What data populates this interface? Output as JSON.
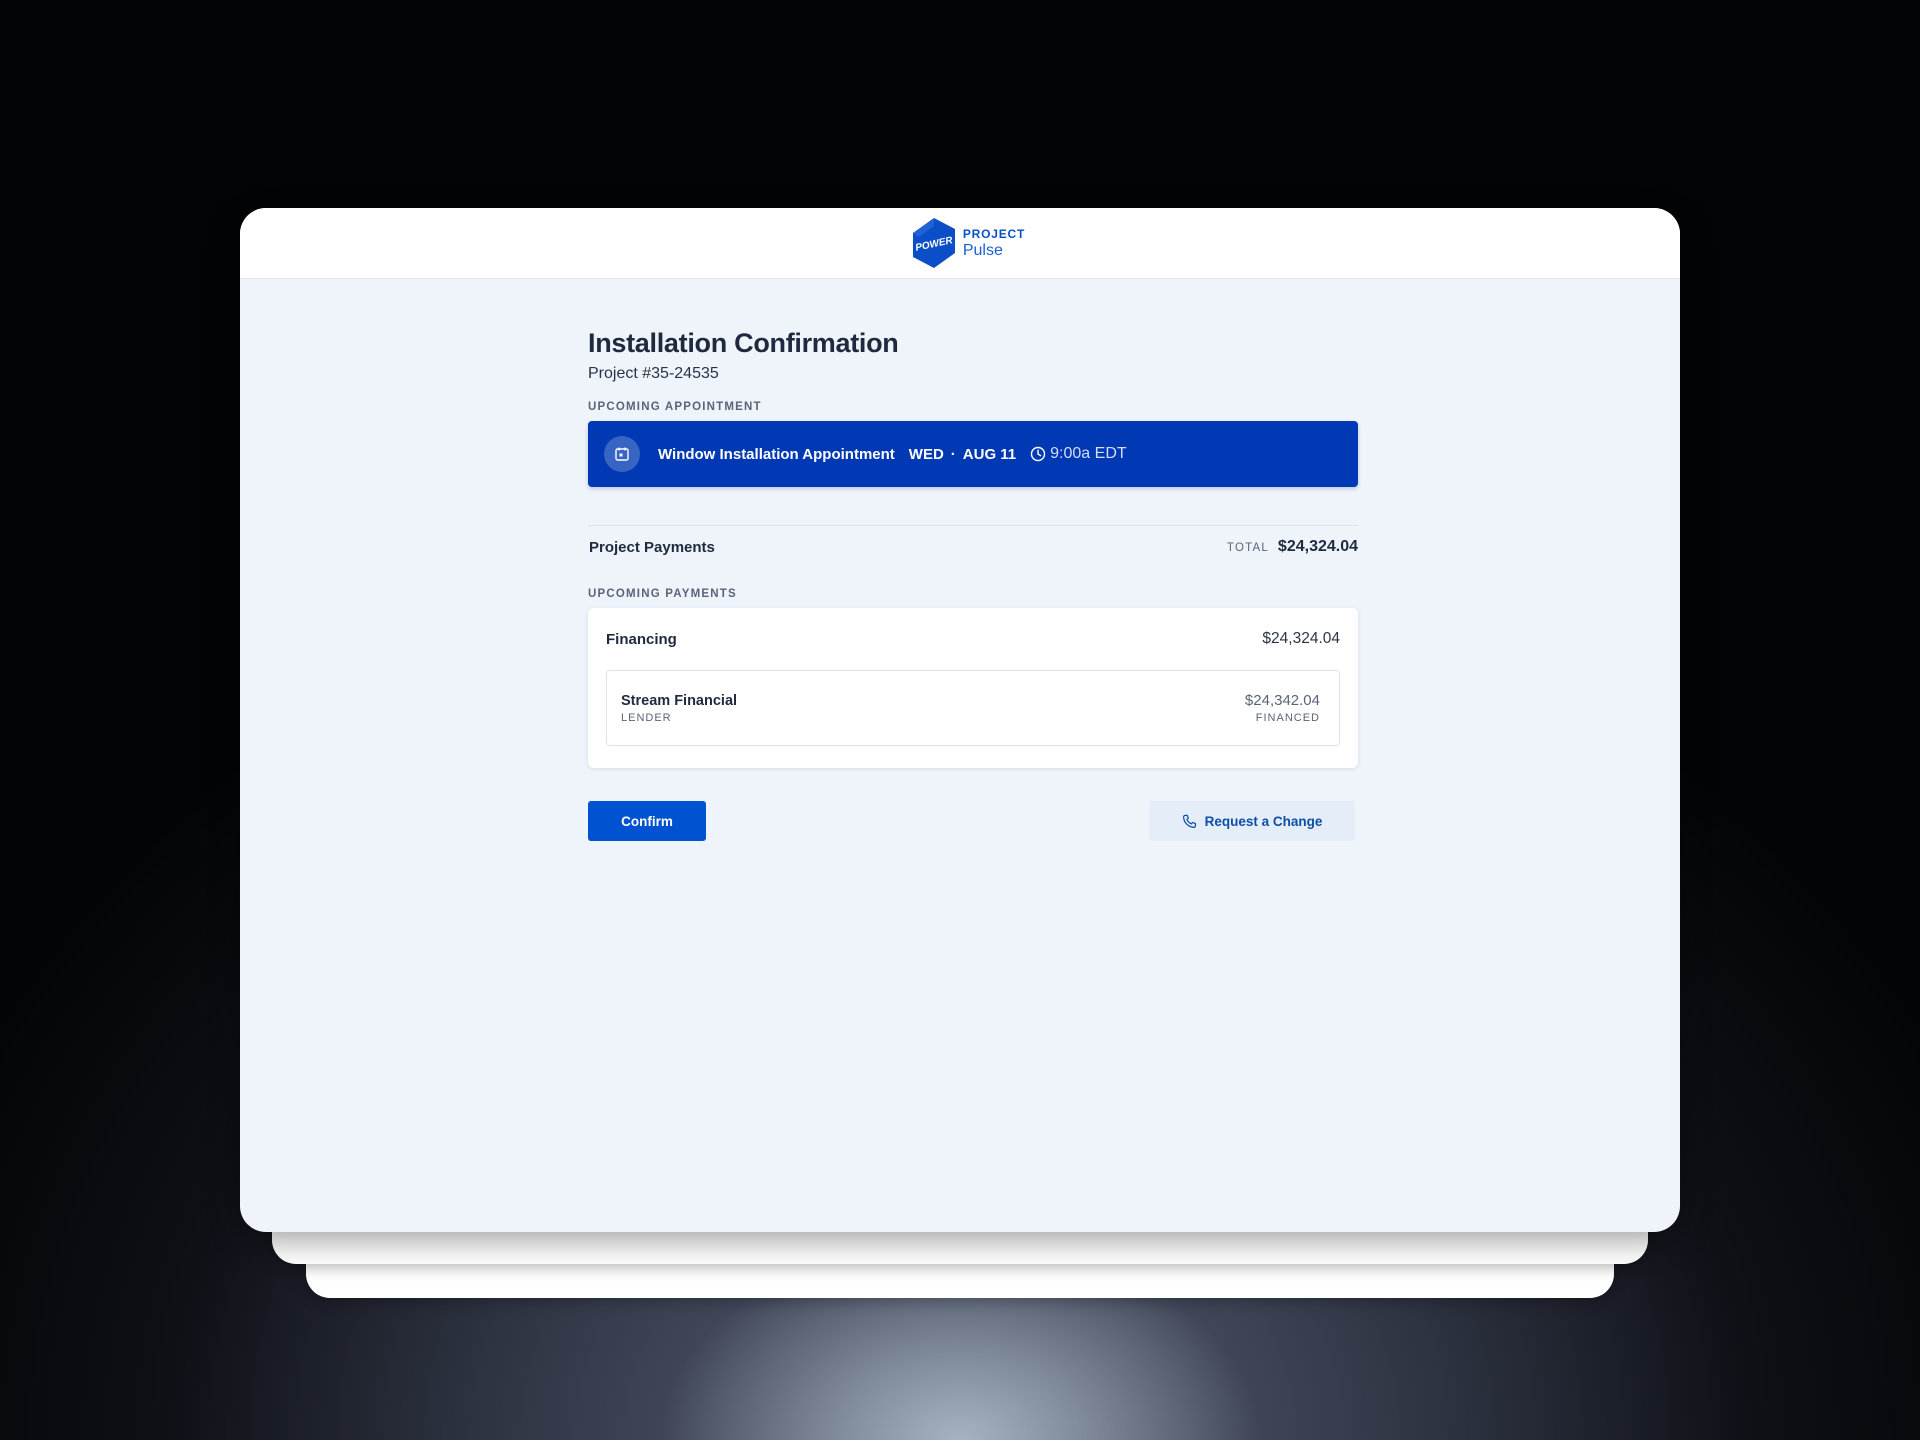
{
  "brand": {
    "logo_text": "POWER",
    "top": "PROJECT",
    "bottom": "Pulse"
  },
  "page": {
    "title": "Installation Confirmation",
    "project_number": "Project #35-24535"
  },
  "appointment": {
    "section_label": "UPCOMING APPOINTMENT",
    "title": "Window Installation Appointment",
    "day": "WED",
    "separator": "·",
    "date": "AUG 11",
    "time": "9:00a EDT",
    "icon": "calendar-icon"
  },
  "payments": {
    "title": "Project Payments",
    "total_label": "TOTAL",
    "total_amount": "$24,324.04",
    "upcoming_label": "UPCOMING PAYMENTS",
    "financing": {
      "title": "Financing",
      "amount": "$24,324.04",
      "lender_name": "Stream Financial",
      "lender_label": "LENDER",
      "financed_amount": "$24,342.04",
      "financed_label": "FINANCED"
    }
  },
  "actions": {
    "confirm_label": "Confirm",
    "change_label": "Request a Change",
    "change_icon": "phone-icon"
  },
  "colors": {
    "accent": "#0039b3",
    "primary_button": "#0052d0",
    "secondary_button_bg": "#e4edf8",
    "page_bg": "#eff4fb"
  }
}
